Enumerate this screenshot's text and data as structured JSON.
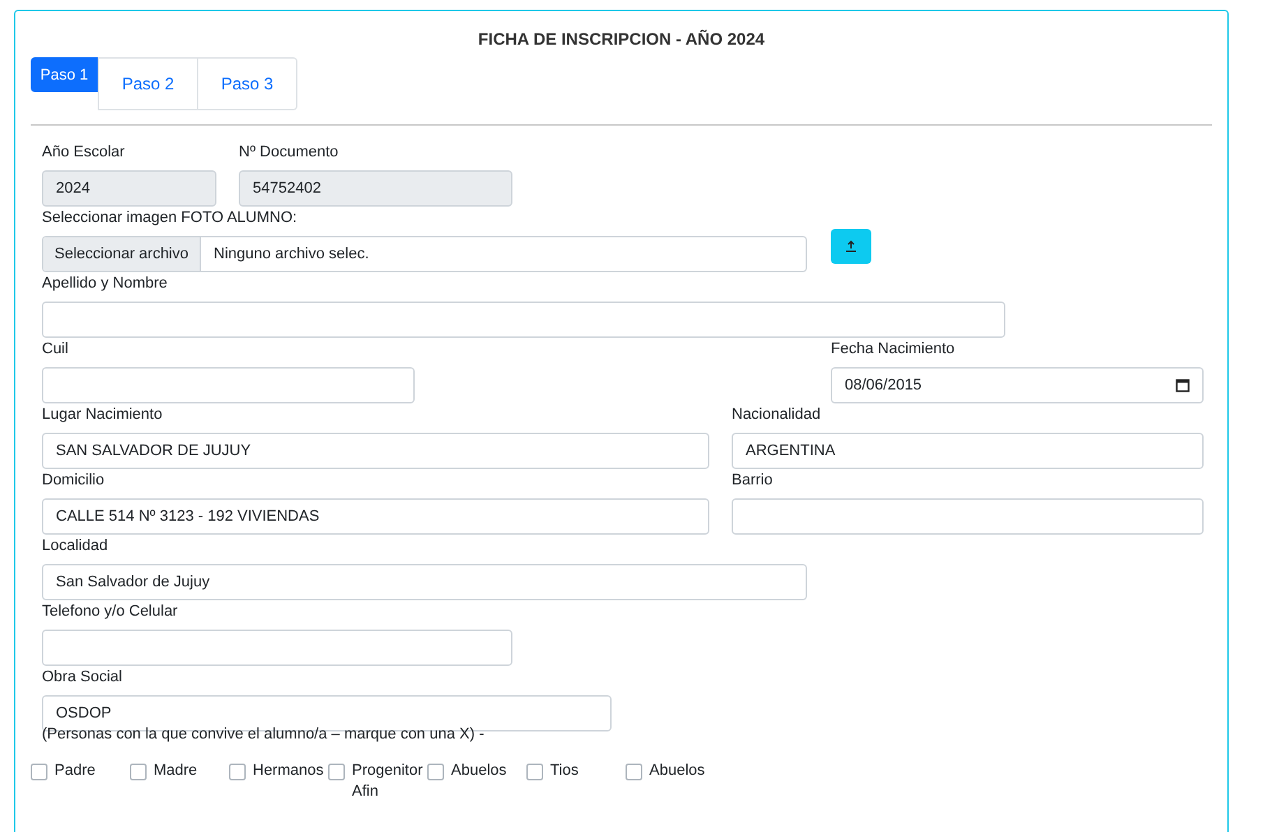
{
  "title": "FICHA DE INSCRIPCION - AÑO 2024",
  "tabs": [
    {
      "label": "Paso 1",
      "selected": true
    },
    {
      "label": "Paso 2",
      "selected": false
    },
    {
      "label": "Paso 3",
      "selected": false
    }
  ],
  "rows": [
    [
      {
        "kind": "text",
        "label": "Año Escolar",
        "value": "2024",
        "disabled": true
      },
      {
        "kind": "text",
        "label": "Nº Documento",
        "value": "54752402",
        "disabled": true
      }
    ],
    [
      {
        "kind": "file",
        "label": "Seleccionar imagen FOTO ALUMNO:",
        "button": "Seleccionar archivo",
        "value": "Ninguno archivo selec."
      },
      {
        "kind": "upload"
      }
    ],
    [
      {
        "kind": "text",
        "label": "Apellido y Nombre",
        "disabled": false
      }
    ],
    [
      {
        "kind": "text",
        "label": "Cuil",
        "disabled": false
      },
      {
        "kind": "date",
        "label": "Fecha Nacimiento",
        "value": "08/06/2015"
      }
    ],
    [
      {
        "kind": "text",
        "label": "Lugar Nacimiento",
        "value": "SAN SALVADOR DE JUJUY",
        "disabled": false
      },
      {
        "kind": "text",
        "label": "Nacionalidad",
        "value": "ARGENTINA",
        "disabled": false
      }
    ],
    [
      {
        "kind": "text",
        "label": "Domicilio",
        "value": "CALLE 514 Nº 3123 - 192 VIVIENDAS",
        "disabled": false
      },
      {
        "kind": "text",
        "label": "Barrio",
        "disabled": false
      }
    ],
    [
      {
        "kind": "text",
        "label": "Localidad",
        "value": "San Salvador de Jujuy",
        "disabled": false
      }
    ],
    [
      {
        "kind": "text",
        "label": "Telefono y/o Celular",
        "disabled": false
      }
    ],
    [
      {
        "kind": "text",
        "label": "Obra Social",
        "value": "OSDOP",
        "disabled": false
      }
    ]
  ],
  "note": "(Personas con la que convive el alumno/a – marque con una X) -",
  "checkboxes": [
    {
      "label": "Padre",
      "checked": false
    },
    {
      "label": "Madre",
      "checked": false
    },
    {
      "label": "Hermanos",
      "checked": false
    },
    {
      "label": "Progenitor Afin",
      "checked": false
    },
    {
      "label": "Abuelos",
      "checked": false
    },
    {
      "label": "Tios",
      "checked": false
    },
    {
      "label": "Abuelos",
      "checked": false
    }
  ]
}
